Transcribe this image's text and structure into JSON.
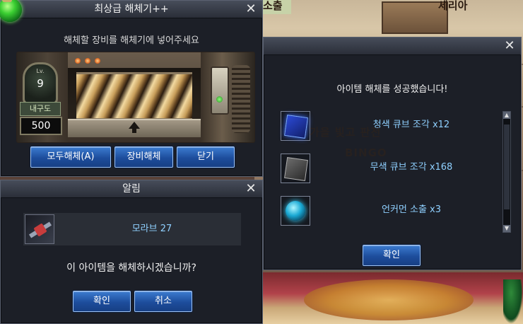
{
  "background": {
    "top_text_left": "소출",
    "top_text_right": "세리아",
    "mid_text_1": "가을 빛고 판전",
    "mid_text_2": "BINGO"
  },
  "disassembler": {
    "title": "최상급 해체기++",
    "instruction": "해체할 장비를 해체기에 넣어주세요",
    "level_label": "Lv.",
    "level_value": "9",
    "durability_label": "내구도",
    "durability_value": "500",
    "buttons": {
      "disassemble_all": "모두해체(A)",
      "disassemble_equipment": "장비해체",
      "close": "닫기"
    }
  },
  "confirm_dialog": {
    "title": "알림",
    "item_name": "모라브 27",
    "question": "이 아이템을 해체하시겠습니까?",
    "buttons": {
      "ok": "확인",
      "cancel": "취소"
    }
  },
  "result_dialog": {
    "message": "아이템 해체를 성공했습니다!",
    "items": [
      {
        "name": "청색 큐브 조각 x12",
        "icon": "blue-cube-fragment-icon"
      },
      {
        "name": "무색 큐브 조각 x168",
        "icon": "colorless-cube-fragment-icon"
      },
      {
        "name": "언커먼 소출 x3",
        "icon": "uncommon-soul-icon"
      }
    ],
    "ok_label": "확인"
  },
  "close_glyph": "✕",
  "colors": {
    "item_text": "#8fd0ff",
    "button_blue": "#1d4d9c"
  }
}
